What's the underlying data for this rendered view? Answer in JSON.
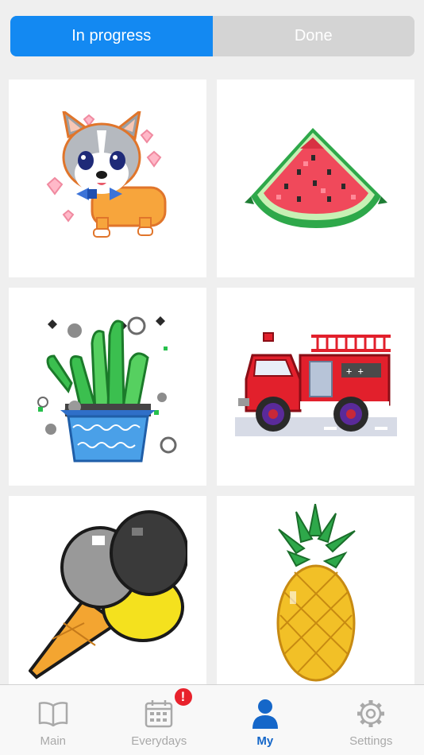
{
  "segmented": {
    "in_progress_label": "In progress",
    "done_label": "Done",
    "selected": "In progress"
  },
  "artworks": [
    {
      "name": "corgi-artwork",
      "icon": "corgi-pixel-art"
    },
    {
      "name": "watermelon-artwork",
      "icon": "watermelon-pixel-art"
    },
    {
      "name": "cactus-artwork",
      "icon": "cactus-pot-pixel-art"
    },
    {
      "name": "firetruck-artwork",
      "icon": "fire-truck-pixel-art"
    },
    {
      "name": "icecream-artwork",
      "icon": "ice-cream-pixel-art"
    },
    {
      "name": "pineapple-artwork",
      "icon": "pineapple-pixel-art"
    }
  ],
  "tabbar": {
    "main_label": "Main",
    "everydays_label": "Everydays",
    "everydays_badge": "!",
    "my_label": "My",
    "settings_label": "Settings",
    "active": "My"
  },
  "colors": {
    "accent": "#1389f2",
    "active_tab": "#1567c9",
    "inactive_tab": "#a9a9a9",
    "badge": "#e8222c"
  }
}
